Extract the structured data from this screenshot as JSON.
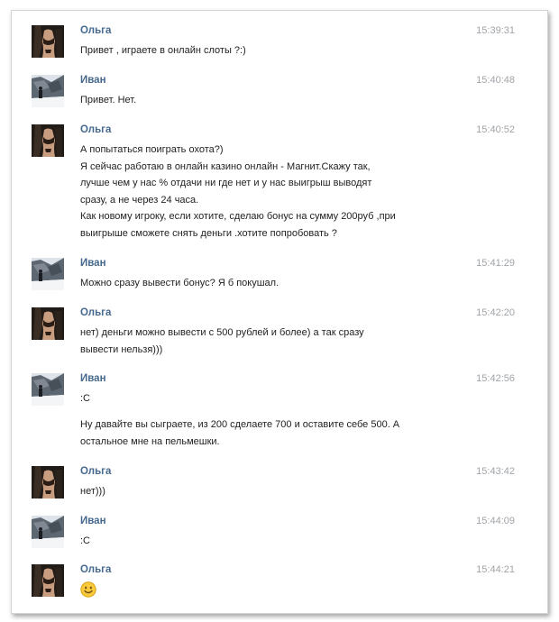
{
  "colors": {
    "name": "#45688e",
    "time": "#a0a4a8",
    "text": "#222222",
    "smiley": "#f5c518"
  },
  "messages": [
    {
      "sender": "Ольга",
      "time": "15:39:31",
      "text": "Привет , играете в онлайн слоты ?:)",
      "avatar": "olga-avatar"
    },
    {
      "sender": "Иван",
      "time": "15:40:48",
      "text": "Привет. Нет.",
      "avatar": "ivan-avatar"
    },
    {
      "sender": "Ольга",
      "time": "15:40:52",
      "text": "А попытаться поиграть охота?)\nЯ сейчас работаю в онлайн казино онлайн - Магнит.Скажу так,\nлучше чем у нас % отдачи ни где нет и у нас выигрыш выводят\nсразу, а не через 24 часа.\nКак новому игроку, если хотите, сделаю бонус на сумму 200руб ,при\nвыигрыше сможете снять деньги .хотите попробовать ?",
      "avatar": "olga-avatar"
    },
    {
      "sender": "Иван",
      "time": "15:41:29",
      "text": "Можно сразу вывести бонус? Я б покушал.",
      "avatar": "ivan-avatar"
    },
    {
      "sender": "Ольга",
      "time": "15:42:20",
      "text": "нет) деньги можно вывести с 500 рублей и более) а так сразу\nвывести нельзя)))",
      "avatar": "olga-avatar"
    },
    {
      "sender": "Иван",
      "time": "15:42:56",
      "text": ":С",
      "text2": "Ну давайте вы сыграете, из 200 сделаете 700 и оставите себе 500. А\nостальное мне на пельмешки.",
      "avatar": "ivan-avatar"
    },
    {
      "sender": "Ольга",
      "time": "15:43:42",
      "text": "нет)))",
      "avatar": "olga-avatar"
    },
    {
      "sender": "Иван",
      "time": "15:44:09",
      "text": ":С",
      "avatar": "ivan-avatar"
    },
    {
      "sender": "Ольга",
      "time": "15:44:21",
      "smiley": "smiley-emoji-icon",
      "avatar": "olga-avatar"
    }
  ]
}
